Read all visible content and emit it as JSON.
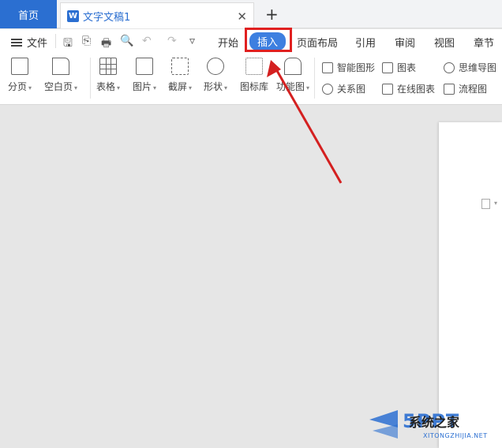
{
  "tabs": {
    "home": "首页",
    "doc_title": "文字文稿1",
    "doc_logo": "W",
    "close": "✕",
    "add": "+"
  },
  "menu": {
    "file": "文件",
    "quick_access": [
      "🖫",
      "⎘",
      "🖶",
      "🔍",
      "↶",
      "↷",
      "▿"
    ],
    "tabs": [
      "开始",
      "插入",
      "页面布局",
      "引用",
      "审阅",
      "视图",
      "章节"
    ],
    "active_tab": "插入"
  },
  "ribbon": {
    "big_buttons": [
      {
        "label": "分页",
        "icon": "page-break-icon",
        "caret": true
      },
      {
        "label": "空白页",
        "icon": "blank-page-icon",
        "caret": true
      },
      {
        "label": "表格",
        "icon": "table-icon",
        "caret": true
      },
      {
        "label": "图片",
        "icon": "picture-icon",
        "caret": true
      },
      {
        "label": "截屏",
        "icon": "screenshot-icon",
        "caret": true
      },
      {
        "label": "形状",
        "icon": "shape-icon",
        "caret": true
      },
      {
        "label": "图标库",
        "icon": "icon-library-icon",
        "caret": false
      },
      {
        "label": "功能图",
        "icon": "function-chart-icon",
        "caret": true
      }
    ],
    "small_buttons": [
      {
        "label": "智能图形",
        "icon": "smart-art-icon"
      },
      {
        "label": "图表",
        "icon": "chart-icon"
      },
      {
        "label": "思维导图",
        "icon": "mind-map-icon"
      },
      {
        "label": "关系图",
        "icon": "relation-diagram-icon"
      },
      {
        "label": "在线图表",
        "icon": "online-chart-icon"
      },
      {
        "label": "流程图",
        "icon": "flowchart-icon"
      }
    ]
  },
  "watermark": {
    "brand": "系统之家",
    "logo_text": "5PPT",
    "url": "XITONGZHIJIA.NET"
  },
  "colors": {
    "accent": "#2b6fd1",
    "highlight": "#e02020",
    "canvas": "#e6e6e6"
  }
}
